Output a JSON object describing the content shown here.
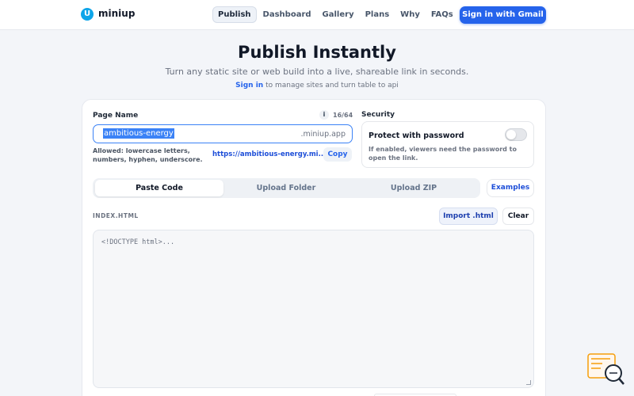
{
  "header": {
    "brand_mark": "U",
    "brand_name": "miniup",
    "nav": [
      {
        "label": "Publish"
      },
      {
        "label": "Dashboard"
      },
      {
        "label": "Gallery"
      },
      {
        "label": "Plans"
      },
      {
        "label": "Why"
      },
      {
        "label": "FAQs"
      }
    ],
    "signin_label": "Sign in with Gmail"
  },
  "hero": {
    "title": "Publish Instantly",
    "subtitle": "Turn any static site or web build into a live, shareable link in seconds.",
    "note_link": "Sign in",
    "note_text": " to manage sites and turn table to api"
  },
  "form": {
    "page_name_label": "Page Name",
    "info_icon": "i",
    "char_count": "16/64",
    "page_name_value": "ambitious-energy",
    "domain_suffix": ".miniup.app",
    "allowed_text": "Allowed: lowercase letters, numbers, hyphen, underscore.",
    "url_preview": "https://ambitious-energy.mi...",
    "copy_label": "Copy",
    "security_label": "Security",
    "protect_title": "Protect with password",
    "protect_desc": "If enabled, viewers need the password to open the link.",
    "protect_enabled": false
  },
  "tabs": [
    {
      "label": "Paste Code",
      "active": true
    },
    {
      "label": "Upload Folder",
      "active": false
    },
    {
      "label": "Upload ZIP",
      "active": false
    }
  ],
  "examples_label": "Examples",
  "editor": {
    "file_label": "INDEX.HTML",
    "import_label": "Import .html",
    "clear_label": "Clear",
    "placeholder": "<!DOCTYPE html>..."
  },
  "colors": {
    "accent": "#2563eb",
    "logo": "#0ea5e9",
    "widget": "#f59e0b"
  }
}
